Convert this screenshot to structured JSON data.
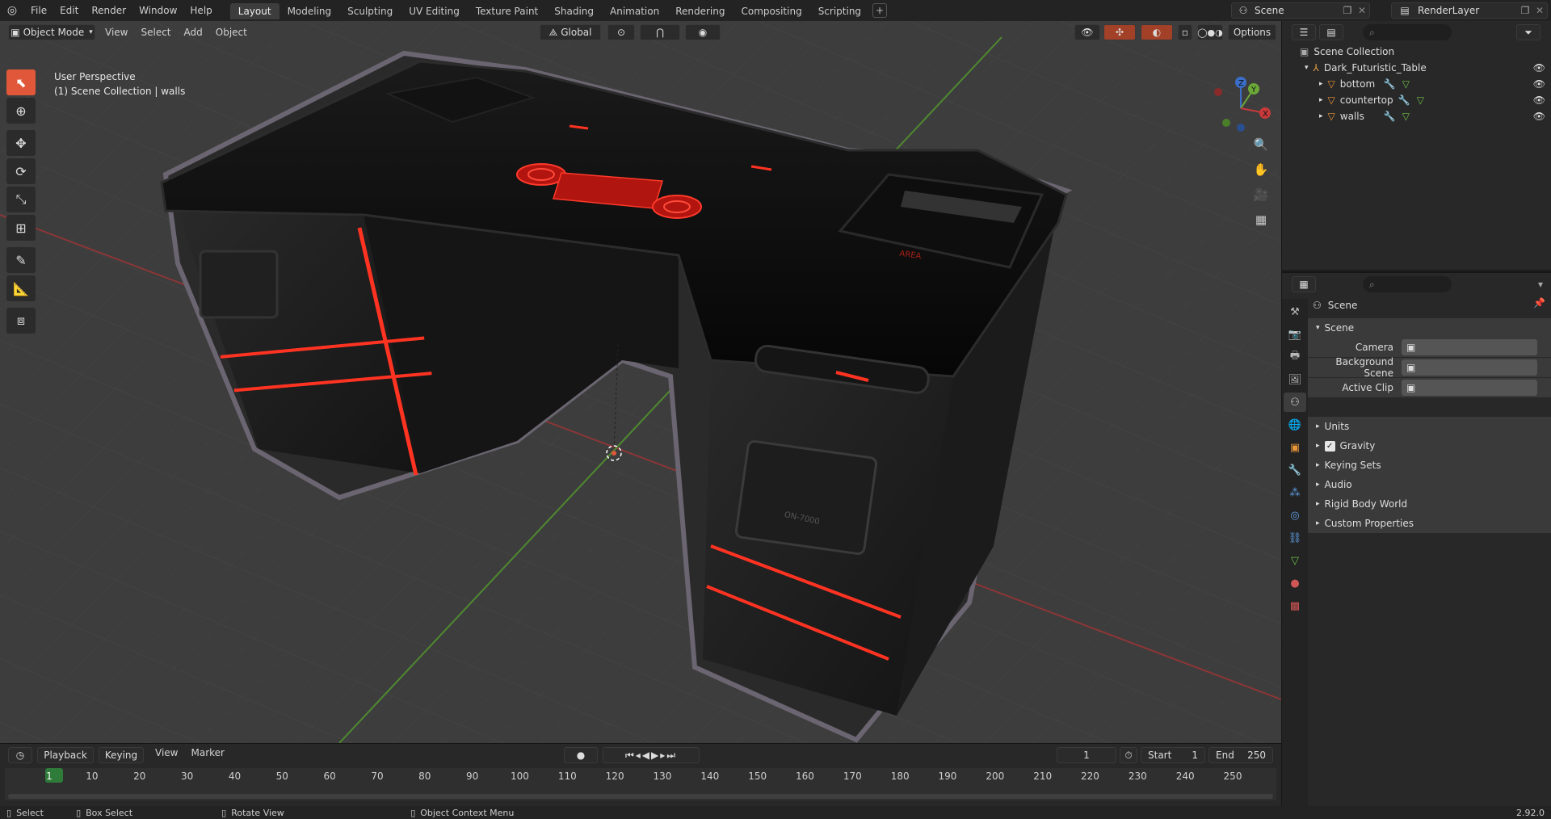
{
  "menu": [
    "File",
    "Edit",
    "Render",
    "Window",
    "Help"
  ],
  "workspaces": [
    "Layout",
    "Modeling",
    "Sculpting",
    "UV Editing",
    "Texture Paint",
    "Shading",
    "Animation",
    "Rendering",
    "Compositing",
    "Scripting"
  ],
  "active_workspace": "Layout",
  "scene_name": "Scene",
  "view_layer": "RenderLayer",
  "viewport": {
    "mode": "Object Mode",
    "menus": [
      "View",
      "Select",
      "Add",
      "Object"
    ],
    "transform_orientation": "Global",
    "options_label": "Options",
    "perspective_label": "User Perspective",
    "collection_label": "(1) Scene Collection | walls",
    "axis_x": "X",
    "axis_y": "Y",
    "axis_z": "Z"
  },
  "model": {
    "panel_text": "ON-7000",
    "top_text": "AREA"
  },
  "outliner": {
    "root": "Scene Collection",
    "collection": "Dark_Futuristic_Table",
    "objects": [
      "bottom",
      "countertop",
      "walls"
    ]
  },
  "properties": {
    "header_title": "Scene",
    "section_title": "Scene",
    "fields": [
      {
        "label": "Camera",
        "value": ""
      },
      {
        "label": "Background Scene",
        "value": ""
      },
      {
        "label": "Active Clip",
        "value": ""
      }
    ],
    "subsections": [
      "Units",
      "Gravity",
      "Keying Sets",
      "Audio",
      "Rigid Body World",
      "Custom Properties"
    ],
    "gravity_checked": true
  },
  "timeline": {
    "menus": [
      "Playback",
      "Keying",
      "View",
      "Marker"
    ],
    "current_frame": "1",
    "start_label": "Start",
    "start": "1",
    "end_label": "End",
    "end": "250",
    "ticks": [
      "1",
      "10",
      "20",
      "30",
      "40",
      "50",
      "60",
      "70",
      "80",
      "90",
      "100",
      "110",
      "120",
      "130",
      "140",
      "150",
      "160",
      "170",
      "180",
      "190",
      "200",
      "210",
      "220",
      "230",
      "240",
      "250"
    ]
  },
  "statusbar": {
    "select": "Select",
    "box_select": "Box Select",
    "rotate_view": "Rotate View",
    "context_menu": "Object Context Menu",
    "version": "2.92.0"
  },
  "colors": {
    "accent": "#e0573a",
    "glow": "#ff2a1a",
    "grid_red": "#9c3b3b",
    "grid_green": "#5f9c3a"
  }
}
